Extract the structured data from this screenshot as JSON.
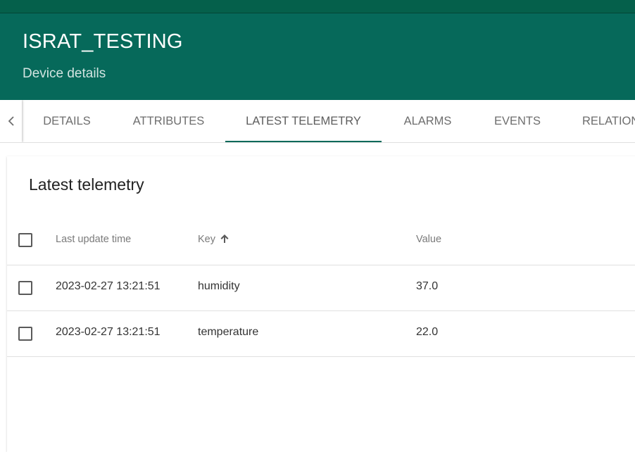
{
  "header": {
    "title": "ISRAT_TESTING",
    "subtitle": "Device details",
    "color": "#06695a"
  },
  "tabs": {
    "prev_icon": "chevron-left-icon",
    "items": [
      {
        "label": "DETAILS"
      },
      {
        "label": "ATTRIBUTES"
      },
      {
        "label": "LATEST TELEMETRY",
        "active": true
      },
      {
        "label": "ALARMS"
      },
      {
        "label": "EVENTS"
      },
      {
        "label": "RELATIONS"
      }
    ]
  },
  "telemetry": {
    "title": "Latest telemetry",
    "columns": {
      "time": "Last update time",
      "key": "Key",
      "value": "Value",
      "sort_icon": "arrow-up-icon"
    },
    "rows": [
      {
        "time": "2023-02-27 13:21:51",
        "key": "humidity",
        "value": "37.0"
      },
      {
        "time": "2023-02-27 13:21:51",
        "key": "temperature",
        "value": "22.0"
      }
    ]
  }
}
